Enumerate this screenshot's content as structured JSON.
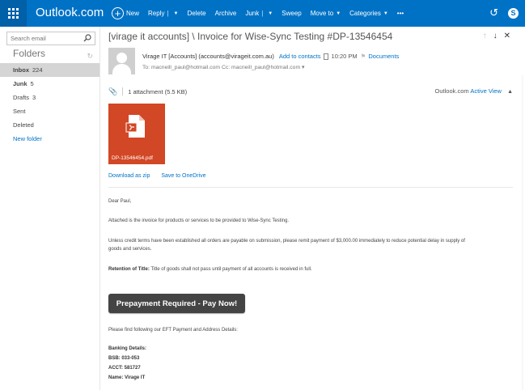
{
  "topbar": {
    "brand": "Outlook.com",
    "commands": {
      "new": "New",
      "reply": "Reply",
      "delete": "Delete",
      "archive": "Archive",
      "junk": "Junk",
      "sweep": "Sweep",
      "move_to": "Move to",
      "categories": "Categories",
      "more": "•••"
    }
  },
  "sidebar": {
    "search_placeholder": "Search email",
    "folders_heading": "Folders",
    "items": [
      {
        "name": "Inbox",
        "count": "224"
      },
      {
        "name": "Junk",
        "count": "5"
      },
      {
        "name": "Drafts",
        "count": "3"
      },
      {
        "name": "Sent",
        "count": ""
      },
      {
        "name": "Deleted",
        "count": ""
      },
      {
        "name": "New folder",
        "count": ""
      }
    ]
  },
  "message": {
    "subject": "[virage it accounts] \\ Invoice for Wise-Sync Testing #DP-13546454",
    "sender": "Virage IT [Accounts] (accounts@virageit.com.au)",
    "add_to_contacts": "Add to contacts",
    "time": "10:20 PM",
    "documents": "Documents",
    "to_line": "To: macneill_paul@hotmail.com Cc: macneill_paul@hotmail.com  ▾",
    "attachment_count": "1 attachment (5.5 KB)",
    "active_view_prefix": "Outlook.com",
    "active_view": "Active View",
    "file_name": "DP-13546454.pdf",
    "download_zip": "Download as zip",
    "save_onedrive": "Save to OneDrive"
  },
  "body": {
    "greeting": "Dear Paul,",
    "line1": "Attached is the invoice for products or services to be provided to Wise-Sync Testing.",
    "line2a": "Unless credit terms have been established all orders are payable on submission, please remit payment of $3,000.00 immediately to reduce potential delay in supply of",
    "line2b": "goods and services.",
    "retention_label": "Retention of Title:",
    "retention_text": " Title of goods shall not pass until payment of all accounts is received in full.",
    "pay_button": "Prepayment Required - Pay Now!",
    "eft_line": "Please find following our EFT Payment and Address Details:",
    "banking_heading": "Banking Details:",
    "bsb": "BSB: 033-053",
    "acct": "ACCT: 581727",
    "name": "Name: Virage IT"
  },
  "colors": {
    "topbar": "#0072c6",
    "waffle": "#0060a8",
    "link": "#0072c6",
    "file_tile": "#d24726",
    "pay_button": "#444444"
  }
}
